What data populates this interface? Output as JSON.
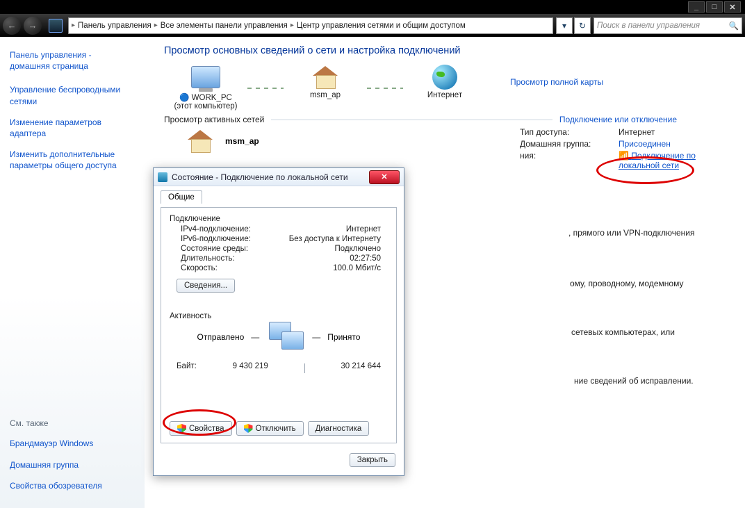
{
  "titlebar": {
    "min": "_",
    "max": "□",
    "close": "✕"
  },
  "nav": {
    "back": "←",
    "fwd": "→",
    "crumbs": [
      "Панель управления",
      "Все элементы панели управления",
      "Центр управления сетями и общим доступом"
    ],
    "refresh": "↻",
    "search_placeholder": "Поиск в панели управления",
    "mag": "🔍"
  },
  "sidebar": {
    "home1": "Панель управления -",
    "home2": "домашняя страница",
    "links": [
      "Управление беспроводными сетями",
      "Изменение параметров адаптера",
      "Изменить дополнительные параметры общего доступа"
    ],
    "see_also": "См. также",
    "extra": [
      "Брандмауэр Windows",
      "Домашняя группа",
      "Свойства обозревателя"
    ]
  },
  "content": {
    "heading": "Просмотр основных сведений о сети и настройка подключений",
    "node_pc": "WORK_PC",
    "node_pc_sub": "(этот компьютер)",
    "node_net": "msm_ap",
    "node_internet": "Интернет",
    "map_link": "Просмотр полной карты",
    "active_label": "Просмотр активных сетей",
    "connect_link": "Подключение или отключение",
    "net_name": "msm_ap",
    "kv": {
      "k1": "Тип доступа:",
      "v1": "Интернет",
      "k2": "Домашняя группа:",
      "v2": "Присоединен",
      "k3": "",
      "v3_a": "Подключение по",
      "v3_b": "локальной сети",
      "k4_suffix": "ния:"
    },
    "partials": [
      ", прямого или VPN-подключения",
      "ому, проводному, модемному",
      "сетевых компьютерах, или",
      "ние сведений об исправлении."
    ]
  },
  "dialog": {
    "title": "Состояние - Подключение по локальной сети",
    "close": "✕",
    "tab": "Общие",
    "group1": "Подключение",
    "rows": [
      {
        "k": "IPv4-подключение:",
        "v": "Интернет"
      },
      {
        "k": "IPv6-подключение:",
        "v": "Без доступа к Интернету"
      },
      {
        "k": "Состояние среды:",
        "v": "Подключено"
      },
      {
        "k": "Длительность:",
        "v": "02:27:50"
      },
      {
        "k": "Скорость:",
        "v": "100.0 Мбит/с"
      }
    ],
    "details_btn": "Сведения...",
    "group2": "Активность",
    "sent": "Отправлено",
    "recv": "Принято",
    "bytes_label": "Байт:",
    "bytes_sent": "9 430 219",
    "bytes_recv": "30 214 644",
    "btn_props": "Свойства",
    "btn_disable": "Отключить",
    "btn_diag": "Диагностика",
    "btn_close": "Закрыть"
  }
}
